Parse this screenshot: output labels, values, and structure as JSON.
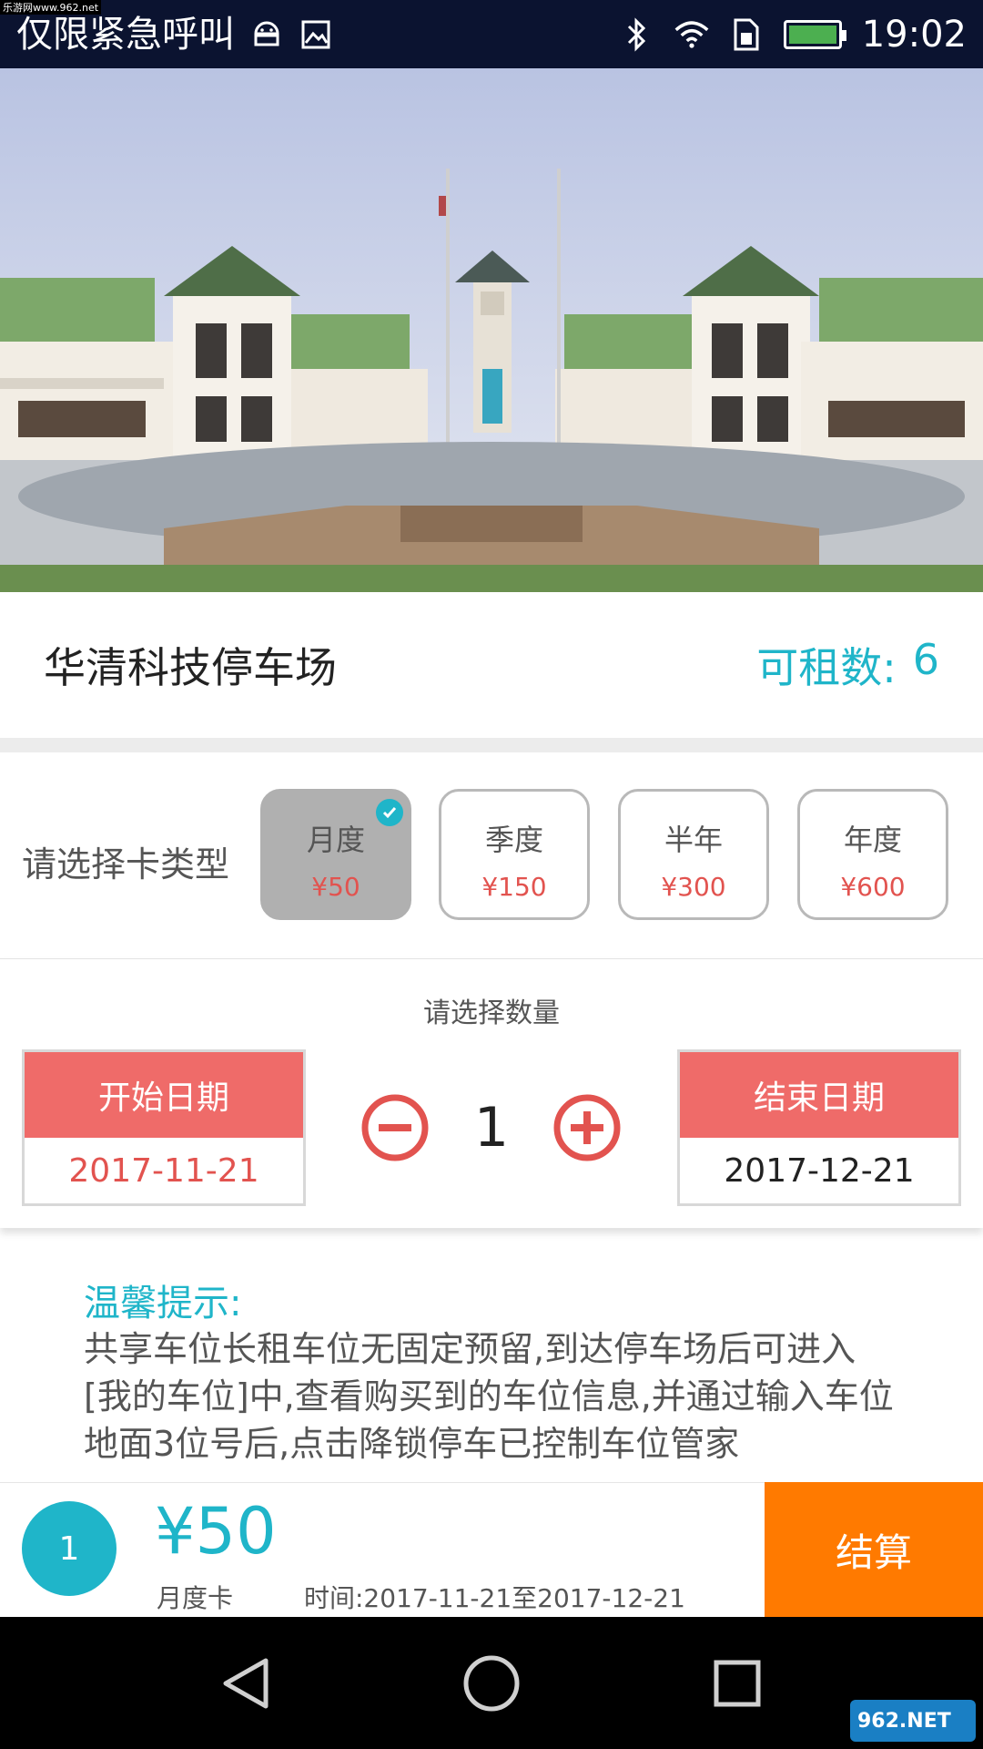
{
  "status_bar": {
    "carrier": "仅限紧急呼叫",
    "time": "19:02",
    "watermark": "乐游网www.962.net",
    "icons": [
      "android-icon",
      "image-icon",
      "bluetooth-icon",
      "wifi-icon",
      "sim-icon",
      "battery-icon"
    ]
  },
  "lot": {
    "name": "华清科技停车场",
    "available_label": "可租数:",
    "available_count": "6"
  },
  "card_type": {
    "label": "请选择卡类型",
    "options": [
      {
        "name": "月度",
        "price": "¥50",
        "selected": true
      },
      {
        "name": "季度",
        "price": "¥150",
        "selected": false
      },
      {
        "name": "半年",
        "price": "¥300",
        "selected": false
      },
      {
        "name": "年度",
        "price": "¥600",
        "selected": false
      }
    ]
  },
  "quantity": {
    "title": "请选择数量",
    "value": "1",
    "start_label": "开始日期",
    "start_date": "2017-11-21",
    "end_label": "结束日期",
    "end_date": "2017-12-21"
  },
  "tips": {
    "title": "温馨提示:",
    "body": "共享车位长租车位无固定预留,到达停车场后可进入[我的车位]中,查看购买到的车位信息,并通过输入车位地面3位号后,点击降锁停车已控制车位管家"
  },
  "checkout": {
    "count": "1",
    "total": "¥50",
    "card_kind": "月度卡",
    "period": "时间:2017-11-21至2017-12-21",
    "button": "结算"
  },
  "colors": {
    "accent": "#1fb5c9",
    "date_header": "#ef6b69",
    "price": "#e2534f",
    "checkout": "#ff7a00",
    "status_bar": "#0b1330"
  },
  "logo": {
    "text": "962.NET",
    "sub": "乐游网"
  }
}
